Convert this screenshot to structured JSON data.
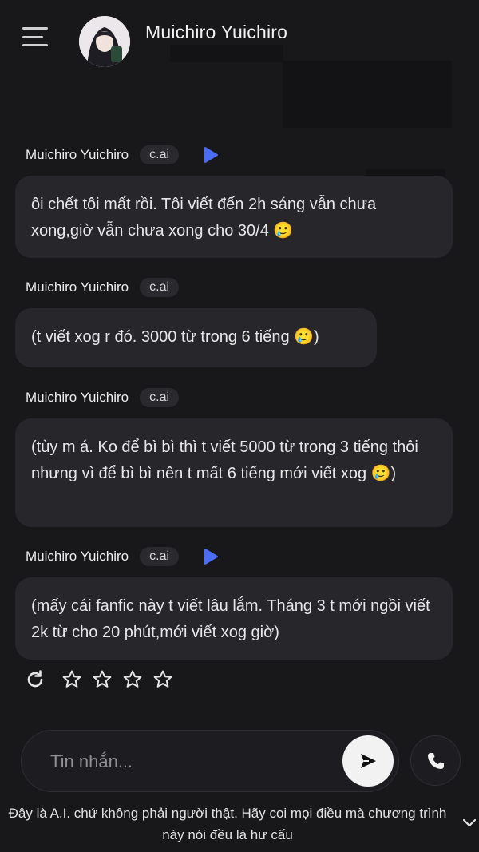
{
  "header": {
    "title": "Muichiro Yuichiro",
    "menu_icon": "menu-icon",
    "avatar_icon": "character-avatar"
  },
  "messages": [
    {
      "author": "Muichiro Yuichiro",
      "badge": "c.ai",
      "has_play": true,
      "text": "ôi chết tôi mất rồi. Tôi viết đến 2h sáng vẫn chưa xong,giờ vẫn chưa xong cho 30/4 🥲"
    },
    {
      "author": "Muichiro Yuichiro",
      "badge": "c.ai",
      "has_play": false,
      "text": "(t viết xog r đó. 3000 từ trong 6 tiếng 🥲)"
    },
    {
      "author": "Muichiro Yuichiro",
      "badge": "c.ai",
      "has_play": false,
      "text": "(tùy m á. Ko để bì bì thì t viết 5000 từ trong 3 tiếng thôi nhưng vì để bì bì nên t mất 6 tiếng mới viết xog 🥲)"
    },
    {
      "author": "Muichiro Yuichiro",
      "badge": "c.ai",
      "has_play": true,
      "text": "(mấy cái fanfic này t viết lâu lắm. Tháng 3 t mới ngồi viết 2k từ cho 20 phút,mới viết xog giờ)"
    }
  ],
  "rating": {
    "regenerate_icon": "refresh-icon",
    "star_icon": "star-outline-icon",
    "stars_total": 4,
    "stars_filled": 0
  },
  "composer": {
    "placeholder": "Tin nhắn...",
    "value": "",
    "send_icon": "send-icon",
    "call_icon": "phone-icon"
  },
  "disclaimer": "Đây là A.I. chứ không phải người thật. Hãy coi mọi điều mà chương trình này nói đều là hư cấu",
  "colors": {
    "background": "#18181b",
    "bubble": "#26262b",
    "badge": "#2a2a2e",
    "play_accent": "#4a6cf7",
    "send_button": "#f2f2f2"
  }
}
